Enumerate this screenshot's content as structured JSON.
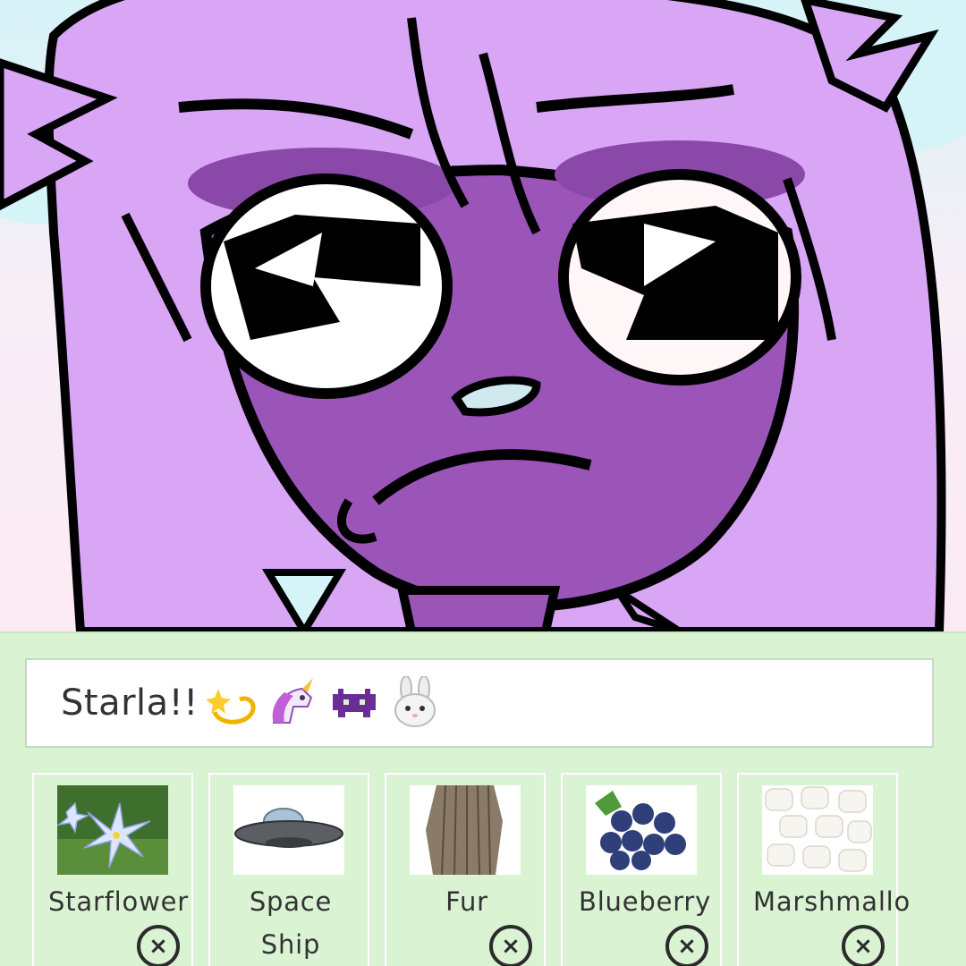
{
  "profile": {
    "name": "Starla!!",
    "emojis": [
      "dizzy-emoji",
      "unicorn-emoji",
      "space-invader-emoji",
      "rabbit-face-emoji"
    ]
  },
  "tags": [
    {
      "label": "Starflower",
      "icon": "starflower-photo"
    },
    {
      "label": "Space\nShip",
      "icon": "space-ship-photo"
    },
    {
      "label": "Fur",
      "icon": "fur-photo"
    },
    {
      "label": "Blueberry",
      "icon": "blueberry-photo"
    },
    {
      "label": "Marshmallo",
      "icon": "marshmallow-photo"
    }
  ],
  "remove_glyph": "×",
  "colors": {
    "panel_bg": "#d9f3d3",
    "hair": "#d9a5f5",
    "skin": "#9b55b9",
    "outline": "#000000"
  }
}
